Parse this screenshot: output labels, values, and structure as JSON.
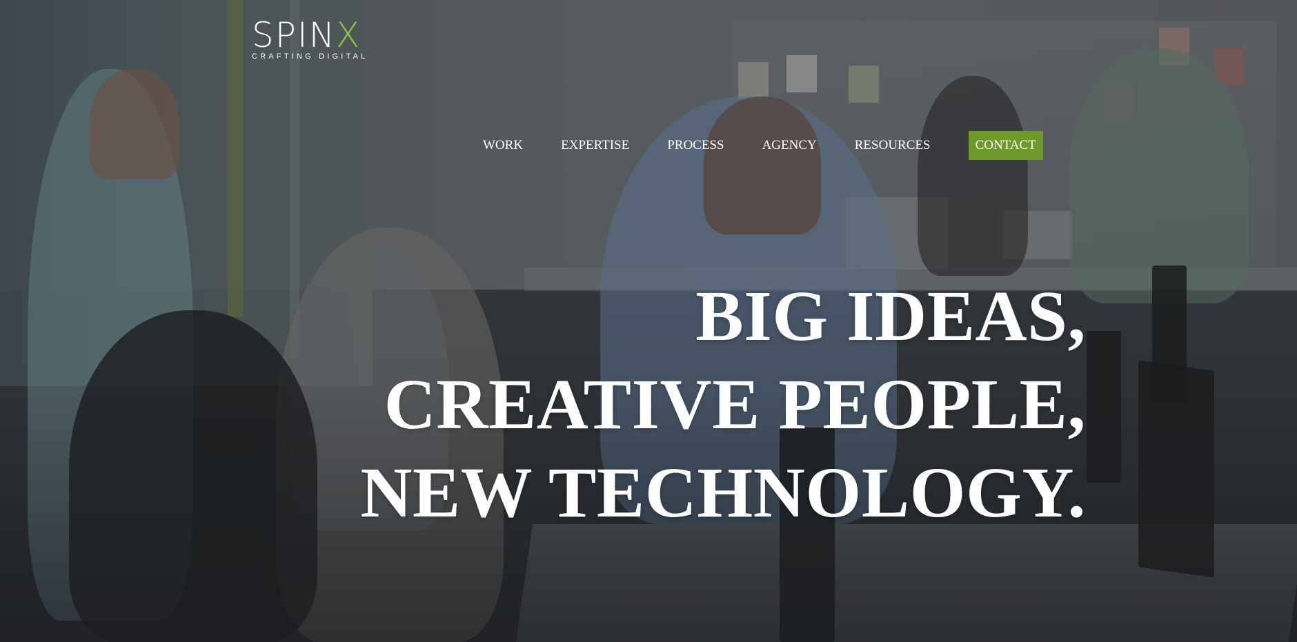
{
  "brand": {
    "logo_main": "SPIN",
    "logo_accent": "X",
    "tagline": "CRAFTING DIGITAL",
    "accent_color": "#8bc53f"
  },
  "nav": {
    "items": [
      {
        "label": "WORK"
      },
      {
        "label": "EXPERTISE"
      },
      {
        "label": "PROCESS"
      },
      {
        "label": "AGENCY"
      },
      {
        "label": "RESOURCES"
      },
      {
        "label": "CONTACT"
      }
    ],
    "cta_color": "#6d9a2a"
  },
  "hero": {
    "headline_lines": [
      "BIG IDEAS,",
      "CREATIVE PEOPLE,",
      "NEW TECHNOLOGY."
    ]
  }
}
